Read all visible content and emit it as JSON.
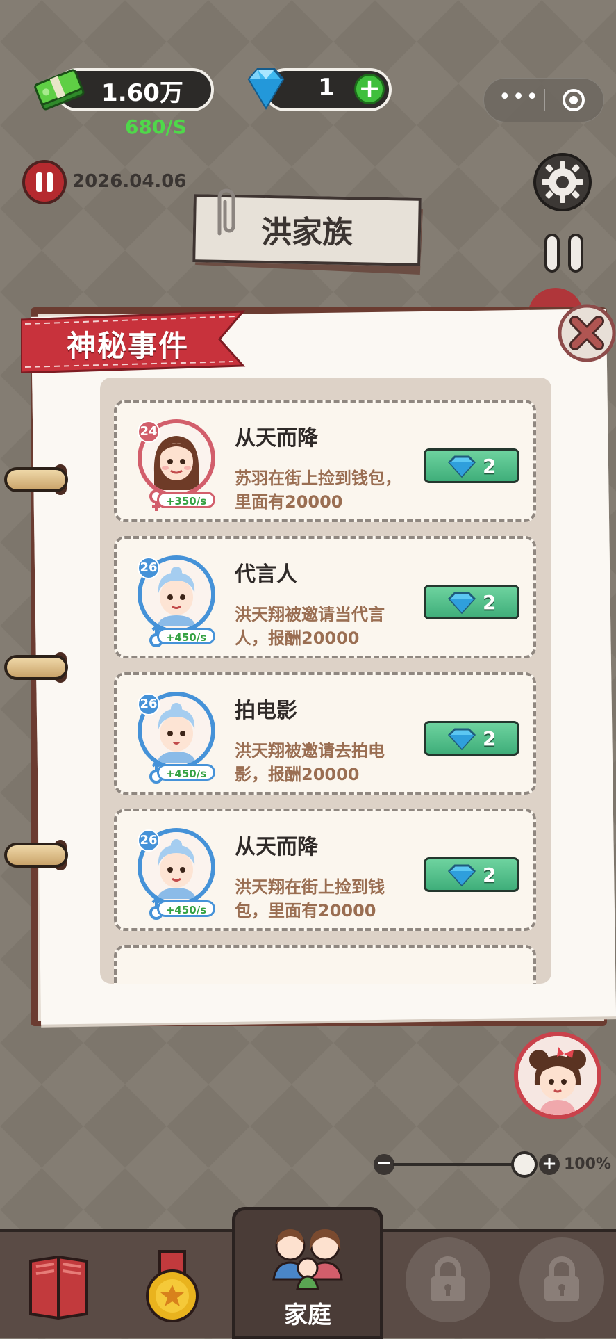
{
  "hud": {
    "money": "1.60万",
    "rate": "680/S",
    "gems": "1",
    "date": "2026.04.06",
    "zoom": "100%"
  },
  "family": {
    "name": "洪家族"
  },
  "dialog": {
    "title": "神秘事件",
    "events": [
      {
        "level": "24",
        "gender": "female",
        "income": "+350/s",
        "title": "从天而降",
        "desc": "苏羽在街上捡到钱包，里面有20000",
        "cost": "2"
      },
      {
        "level": "26",
        "gender": "male",
        "income": "+450/s",
        "title": "代言人",
        "desc": "洪天翔被邀请当代言人，报酬20000",
        "cost": "2"
      },
      {
        "level": "26",
        "gender": "male",
        "income": "+450/s",
        "title": "拍电影",
        "desc": "洪天翔被邀请去拍电影，报酬20000",
        "cost": "2"
      },
      {
        "level": "26",
        "gender": "male",
        "income": "+450/s",
        "title": "从天而降",
        "desc": "洪天翔在街上捡到钱包，里面有20000",
        "cost": "2"
      }
    ]
  },
  "nav": {
    "family_label": "家庭"
  },
  "colors": {
    "accent_green": "#3fae7a",
    "ribbon_red": "#c8323c",
    "female": "#d25e6b",
    "male": "#4592d8"
  }
}
